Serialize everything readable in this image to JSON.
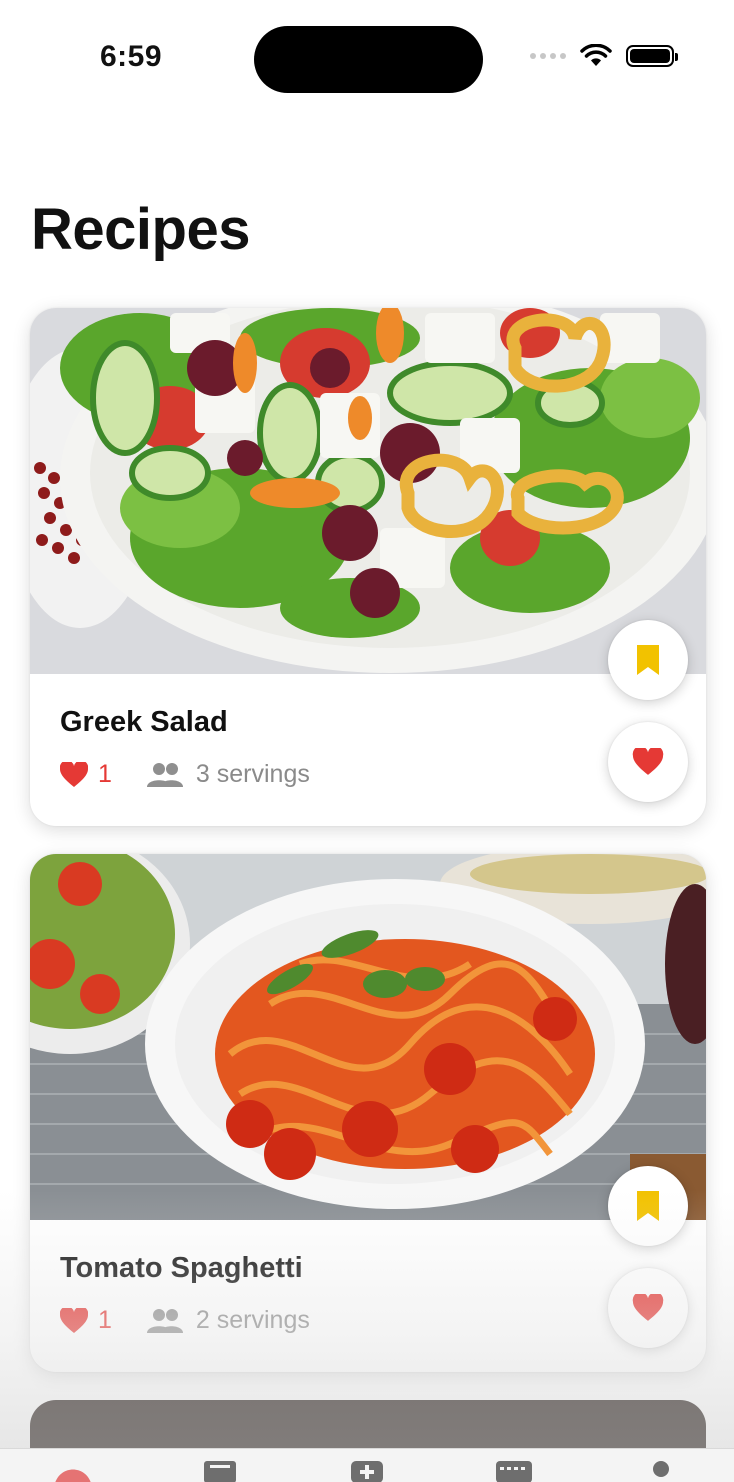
{
  "status_bar": {
    "time": "6:59"
  },
  "page": {
    "title": "Recipes"
  },
  "colors": {
    "accent_red": "#e53935",
    "bookmark_yellow": "#f2c200"
  },
  "recipes": [
    {
      "title": "Greek Salad",
      "likes": "1",
      "servings": "3 servings",
      "image": "greek-salad-photo"
    },
    {
      "title": "Tomato Spaghetti",
      "likes": "1",
      "servings": "2 servings",
      "image": "tomato-spaghetti-photo"
    }
  ],
  "tab_bar": {
    "items": [
      {
        "icon": "recipes-tab-icon"
      },
      {
        "icon": "book-tab-icon"
      },
      {
        "icon": "add-tab-icon"
      },
      {
        "icon": "calendar-tab-icon"
      },
      {
        "icon": "profile-tab-icon"
      }
    ]
  }
}
